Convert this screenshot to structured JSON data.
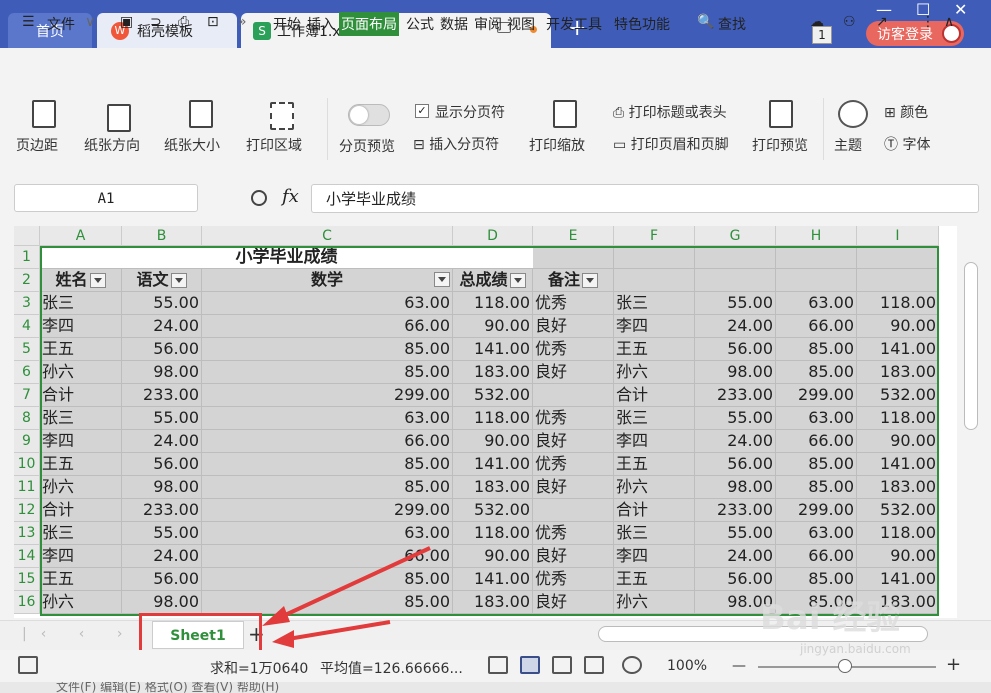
{
  "tabs": {
    "home": "首页",
    "template": "稻壳模板",
    "template_icon": "W",
    "doc": "工作簿1.xlsx",
    "doc_icon": "S",
    "new_tab": "+"
  },
  "titlebar": {
    "badge": "1",
    "login": "访客登录",
    "minimize": "—",
    "restore": "☐",
    "close": "✕"
  },
  "menu": {
    "file": "文件",
    "items": [
      "开始",
      "插入",
      "页面布局",
      "公式",
      "数据",
      "审阅",
      "视图",
      "开发工具",
      "特色功能"
    ],
    "active": "页面布局",
    "search": "查找"
  },
  "ribbon": {
    "margin": "页边距",
    "orientation": "纸张方向",
    "size": "纸张大小",
    "print_area": "打印区域",
    "page_break_preview": "分页预览",
    "show_page_break": "显示分页符",
    "insert_page_break": "插入分页符",
    "print_scale": "打印缩放",
    "print_titles": "打印标题或表头",
    "print_header_footer": "打印页眉和页脚",
    "print_preview": "打印预览",
    "theme": "主题",
    "color": "颜色",
    "font": "字体"
  },
  "formula_bar": {
    "cell_ref": "A1",
    "fx": "fx",
    "content": "小学毕业成绩"
  },
  "sheet": {
    "columns": [
      "A",
      "B",
      "C",
      "D",
      "E",
      "F",
      "G",
      "H",
      "I"
    ],
    "rows": [
      "1",
      "2",
      "3",
      "4",
      "5",
      "6",
      "7",
      "8",
      "9",
      "10",
      "11",
      "12",
      "13",
      "14",
      "15",
      "16"
    ],
    "title": "小学毕业成绩",
    "headers": [
      "姓名",
      "语文",
      "数学",
      "总成绩",
      "备注"
    ],
    "data": [
      [
        "张三",
        "55.00",
        "63.00",
        "118.00",
        "优秀",
        "张三",
        "55.00",
        "63.00",
        "118.00"
      ],
      [
        "李四",
        "24.00",
        "66.00",
        "90.00",
        "良好",
        "李四",
        "24.00",
        "66.00",
        "90.00"
      ],
      [
        "王五",
        "56.00",
        "85.00",
        "141.00",
        "优秀",
        "王五",
        "56.00",
        "85.00",
        "141.00"
      ],
      [
        "孙六",
        "98.00",
        "85.00",
        "183.00",
        "良好",
        "孙六",
        "98.00",
        "85.00",
        "183.00"
      ],
      [
        "合计",
        "233.00",
        "299.00",
        "532.00",
        "",
        "合计",
        "233.00",
        "299.00",
        "532.00"
      ],
      [
        "张三",
        "55.00",
        "63.00",
        "118.00",
        "优秀",
        "张三",
        "55.00",
        "63.00",
        "118.00"
      ],
      [
        "李四",
        "24.00",
        "66.00",
        "90.00",
        "良好",
        "李四",
        "24.00",
        "66.00",
        "90.00"
      ],
      [
        "王五",
        "56.00",
        "85.00",
        "141.00",
        "优秀",
        "王五",
        "56.00",
        "85.00",
        "141.00"
      ],
      [
        "孙六",
        "98.00",
        "85.00",
        "183.00",
        "良好",
        "孙六",
        "98.00",
        "85.00",
        "183.00"
      ],
      [
        "合计",
        "233.00",
        "299.00",
        "532.00",
        "",
        "合计",
        "233.00",
        "299.00",
        "532.00"
      ],
      [
        "张三",
        "55.00",
        "63.00",
        "118.00",
        "优秀",
        "张三",
        "55.00",
        "63.00",
        "118.00"
      ],
      [
        "李四",
        "24.00",
        "66.00",
        "90.00",
        "良好",
        "李四",
        "24.00",
        "66.00",
        "90.00"
      ],
      [
        "王五",
        "56.00",
        "85.00",
        "141.00",
        "优秀",
        "王五",
        "56.00",
        "85.00",
        "141.00"
      ],
      [
        "孙六",
        "98.00",
        "85.00",
        "183.00",
        "良好",
        "孙六",
        "98.00",
        "85.00",
        "183.00"
      ]
    ]
  },
  "sheet_tabs": {
    "active": "Sheet1",
    "add": "+"
  },
  "status": {
    "sum": "求和=1万0640",
    "avg": "平均值=126.66666...",
    "zoom": "100%",
    "zoom_minus": "—",
    "zoom_plus": "+"
  },
  "underlay": {
    "menu": "文件(F)   编辑(E)   格式(O)   查看(V)   帮助(H)"
  },
  "watermark": {
    "text": "Bai 经验",
    "url": "jingyan.baidu.com"
  },
  "colors": {
    "accent": "#2f8f3b",
    "tabbar": "#3f5db8",
    "annotation": "#e23b3b"
  }
}
